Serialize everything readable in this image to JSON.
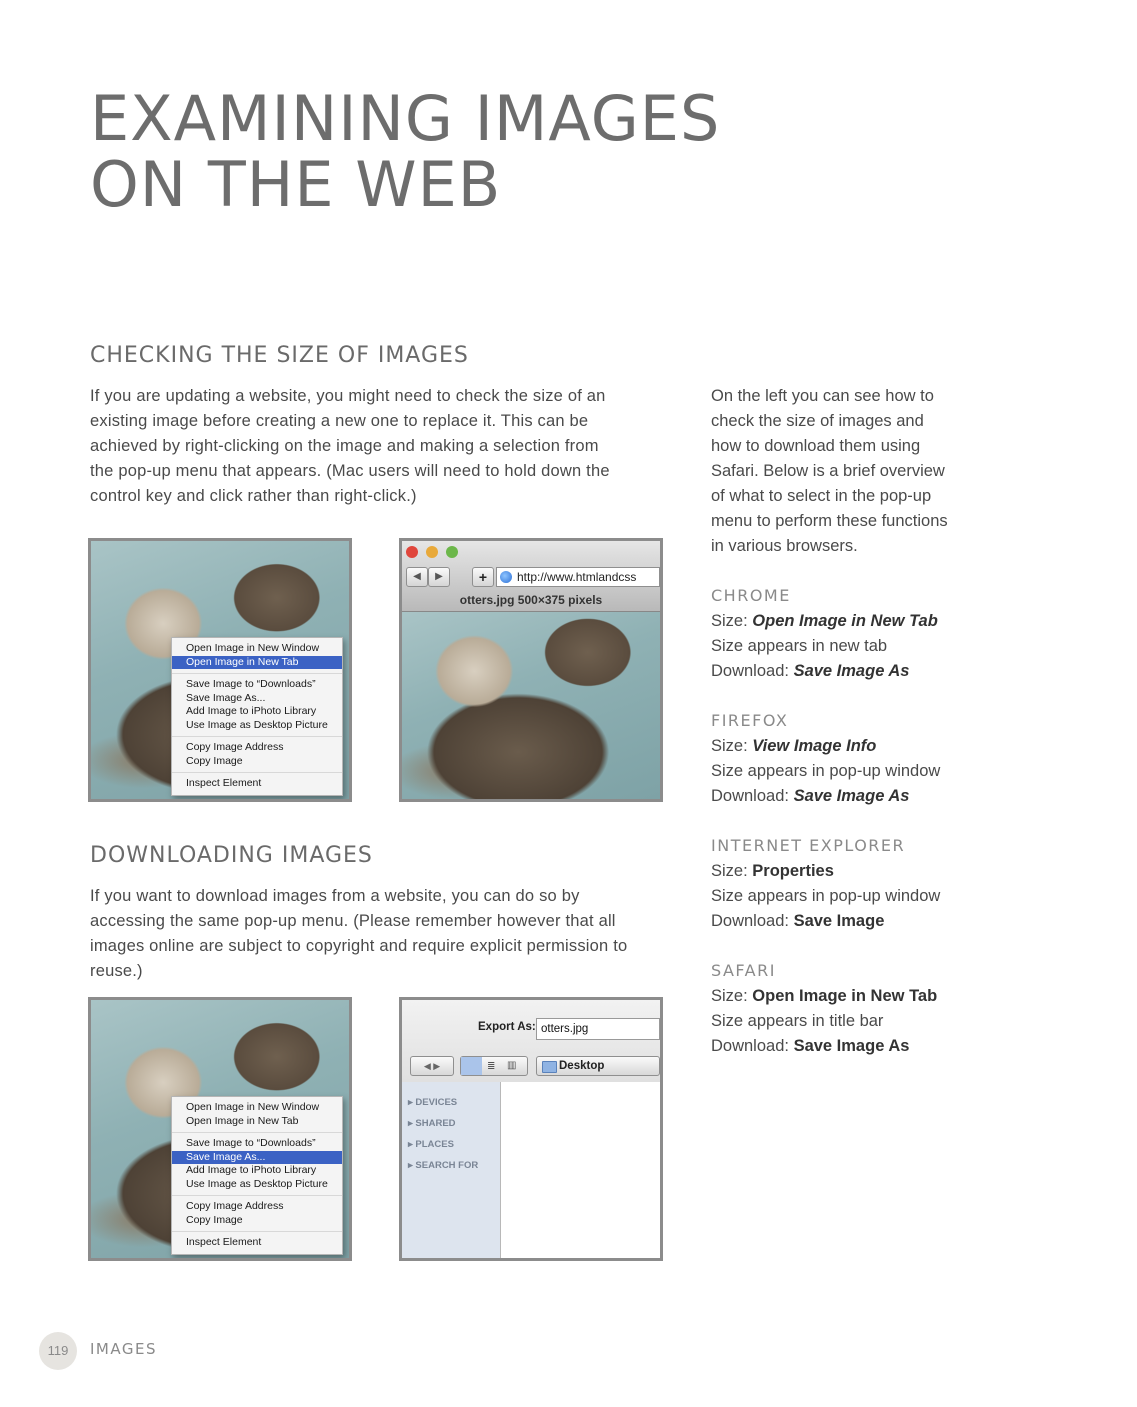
{
  "title_line1": "EXAMINING IMAGES",
  "title_line2": "ON THE WEB",
  "section1": {
    "heading": "CHECKING THE SIZE OF IMAGES",
    "lines": [
      "If you are updating a website, you might need to check the size of an",
      "existing image before creating a new one to replace it. This can be",
      "achieved by right-clicking on the image and making a selection from",
      "the pop-up menu that appears. (Mac users will need to hold down the",
      "control key and click rather than right-click.)"
    ]
  },
  "section2": {
    "heading": "DOWNLOADING IMAGES",
    "lines": [
      "If you want to download images from a website, you can do so by",
      "accessing the same pop-up menu. (Please remember however that all",
      "images online are subject to copyright and require explicit permission to",
      "reuse.)"
    ]
  },
  "menu1": [
    "Open Image in New Window",
    "Open Image in New Tab",
    "Save Image to “Downloads”",
    "Save Image As...",
    "Add Image to iPhoto Library",
    "Use Image as Desktop Picture",
    "Copy Image Address",
    "Copy Image",
    "Inspect Element"
  ],
  "menu2": [
    "Open Image in New Window",
    "Open Image in New Tab",
    "Save Image to “Downloads”",
    "Save Image As...",
    "Add Image to iPhoto Library",
    "Use Image as Desktop Picture",
    "Copy Image Address",
    "Copy Image",
    "Inspect Element"
  ],
  "browser": {
    "url": "http://www.htmlandcss",
    "tab_title": "otters.jpg 500×375 pixels",
    "plus": "+"
  },
  "save_dialog": {
    "export_label": "Export As:",
    "filename": "otters.jpg",
    "location": "Desktop",
    "sidebar": [
      "DEVICES",
      "SHARED",
      "PLACES",
      "SEARCH FOR"
    ]
  },
  "sidebar": {
    "intro": [
      "On the left you can see how to",
      "check the size of images and",
      "how to download them using",
      "Safari. Below is a brief overview",
      "of what to select in the pop-up",
      "menu to perform these functions",
      "in various browsers."
    ],
    "browsers": [
      {
        "name": "CHROME",
        "size_prefix": "Size: ",
        "size_value": "Open Image in New Tab",
        "note": "Size appears in new tab",
        "download_prefix": "Download: ",
        "download_value": "Save Image As"
      },
      {
        "name": "FIREFOX",
        "size_prefix": "Size: ",
        "size_value": "View Image Info",
        "note": "Size appears in pop-up window",
        "download_prefix": "Download: ",
        "download_value": "Save Image As"
      },
      {
        "name": "INTERNET EXPLORER",
        "size_prefix": "Size: ",
        "size_value": "Properties",
        "note": "Size appears in pop-up window",
        "download_prefix": "Download: ",
        "download_value": "Save Image"
      },
      {
        "name": "SAFARI",
        "size_prefix": "Size: ",
        "size_value": "Open Image in New Tab",
        "note": "Size appears in title bar",
        "download_prefix": "Download: ",
        "download_value": "Save Image As"
      }
    ]
  },
  "footer": {
    "page_number": "119",
    "section": "IMAGES"
  }
}
